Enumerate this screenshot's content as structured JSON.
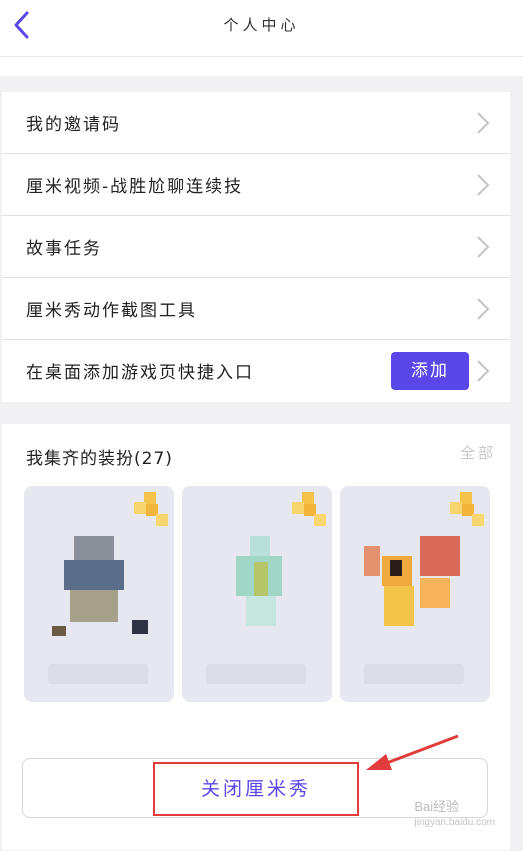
{
  "header": {
    "title": "个人中心"
  },
  "menu": {
    "items": [
      {
        "label": "我的邀请码"
      },
      {
        "label": "厘米视频-战胜尬聊连续技"
      },
      {
        "label": "故事任务"
      },
      {
        "label": "厘米秀动作截图工具"
      },
      {
        "label": "在桌面添加游戏页快捷入口"
      }
    ],
    "add_label": "添加"
  },
  "collection": {
    "title": "我集齐的装扮(27)",
    "all_label": "全部"
  },
  "footer": {
    "close_label": "关闭厘米秀"
  },
  "watermark": {
    "line1": "Bai经验",
    "line2": "jingyan.baidu.com"
  },
  "colors": {
    "accent": "#5a47ea",
    "highlight": "#e23b3b"
  }
}
